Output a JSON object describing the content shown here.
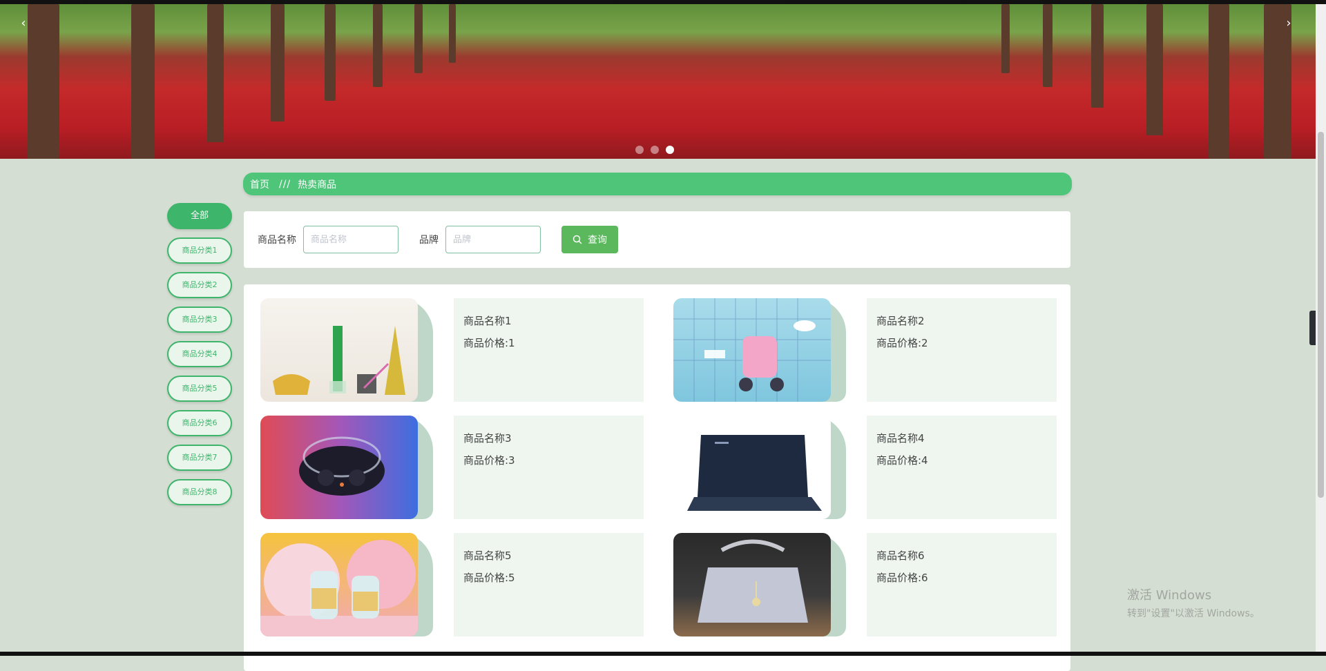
{
  "banner": {
    "slides_total": 3,
    "active_slide": 3
  },
  "breadcrumb": {
    "home": "首页",
    "separator": "///",
    "current": "热卖商品"
  },
  "categories": {
    "all": "全部",
    "items": [
      "商品分类1",
      "商品分类2",
      "商品分类3",
      "商品分类4",
      "商品分类5",
      "商品分类6",
      "商品分类7",
      "商品分类8"
    ]
  },
  "search": {
    "name_label": "商品名称",
    "name_placeholder": "商品名称",
    "brand_label": "品牌",
    "brand_placeholder": "品牌",
    "button_label": "查询"
  },
  "products": [
    {
      "name": "商品名称1",
      "price": "商品价格:1"
    },
    {
      "name": "商品名称2",
      "price": "商品价格:2"
    },
    {
      "name": "商品名称3",
      "price": "商品价格:3"
    },
    {
      "name": "商品名称4",
      "price": "商品价格:4"
    },
    {
      "name": "商品名称5",
      "price": "商品价格:5"
    },
    {
      "name": "商品名称6",
      "price": "商品价格:6"
    }
  ],
  "watermark": {
    "line1": "激活 Windows",
    "line2": "转到\"设置\"以激活 Windows。"
  },
  "colors": {
    "accent": "#4fc57a",
    "category_border": "#3db56b",
    "search_button": "#5bb85d",
    "page_bg": "#d5ded3"
  }
}
